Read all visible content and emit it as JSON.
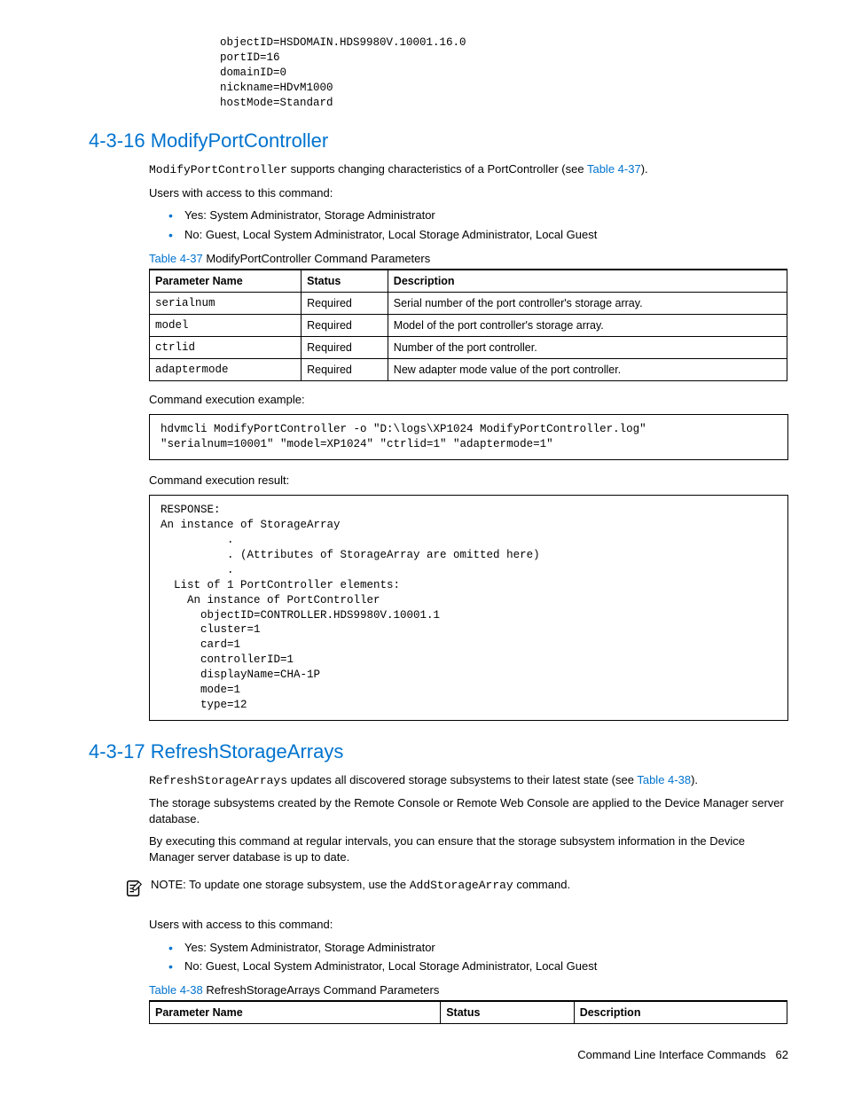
{
  "topCode": "objectID=HSDOMAIN.HDS9980V.10001.16.0\nportID=16\ndomainID=0\nnickname=HDvM1000\nhostMode=Standard",
  "sec16": {
    "heading": "4-3-16 ModifyPortController",
    "intro_cmd": "ModifyPortController",
    "intro_rest": " supports changing characteristics of a PortController (see ",
    "intro_link": "Table 4-37",
    "intro_end": ").",
    "access_label": "Users with access to this command:",
    "bullets": [
      "Yes: System Administrator, Storage Administrator",
      "No: Guest, Local System Administrator, Local Storage Administrator, Local Guest"
    ],
    "table_caption_link": "Table 4-37",
    "table_caption_rest": "  ModifyPortController Command Parameters",
    "table_headers": [
      "Parameter Name",
      "Status",
      "Description"
    ],
    "table_rows": [
      {
        "p": "serialnum",
        "s": "Required",
        "d": "Serial number of the port controller's storage array."
      },
      {
        "p": "model",
        "s": "Required",
        "d": "Model of the port controller's storage array."
      },
      {
        "p": "ctrlid",
        "s": "Required",
        "d": "Number of the port controller."
      },
      {
        "p": "adaptermode",
        "s": "Required",
        "d": "New adapter mode value of the port controller."
      }
    ],
    "exec_example_label": "Command execution example:",
    "exec_example_code": "hdvmcli ModifyPortController -o \"D:\\logs\\XP1024 ModifyPortController.log\"\n\"serialnum=10001\" \"model=XP1024\" \"ctrlid=1\" \"adaptermode=1\"",
    "exec_result_label": "Command execution result:",
    "exec_result_code": "RESPONSE:\nAn instance of StorageArray\n          .\n          . (Attributes of StorageArray are omitted here)\n          .\n  List of 1 PortController elements:\n    An instance of PortController\n      objectID=CONTROLLER.HDS9980V.10001.1\n      cluster=1\n      card=1\n      controllerID=1\n      displayName=CHA-1P\n      mode=1\n      type=12"
  },
  "sec17": {
    "heading": "4-3-17 RefreshStorageArrays",
    "intro_cmd": "RefreshStorageArrays",
    "intro_rest": " updates all discovered storage subsystems to their latest state (see ",
    "intro_link": "Table 4-38",
    "intro_end": ").",
    "p2": "The storage subsystems created by the Remote Console or Remote Web Console are applied to the Device Manager server database.",
    "p3": "By executing this command at regular intervals, you can ensure that the storage subsystem information in the Device Manager server database is up to date.",
    "note_label": "NOTE:  ",
    "note_text1": "To update one storage subsystem, use the ",
    "note_cmd": "AddStorageArray",
    "note_text2": " command.",
    "access_label": "Users with access to this command:",
    "bullets": [
      "Yes: System Administrator, Storage Administrator",
      "No: Guest, Local System Administrator, Local Storage Administrator, Local Guest"
    ],
    "table_caption_link": "Table 4-38",
    "table_caption_rest": "  RefreshStorageArrays Command Parameters",
    "table_headers": [
      "Parameter Name",
      "Status",
      "Description"
    ]
  },
  "footer": {
    "text": "Command Line Interface Commands",
    "page": "62"
  }
}
